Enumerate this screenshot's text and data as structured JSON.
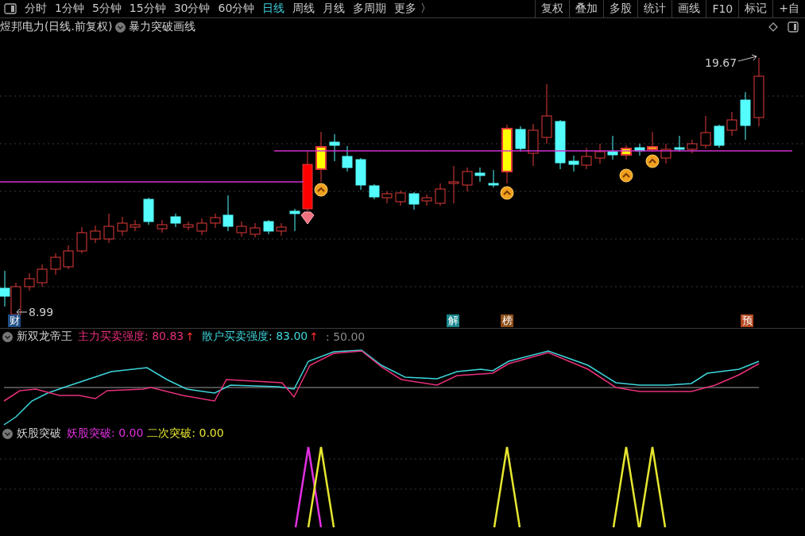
{
  "toolbar": {
    "periods": [
      {
        "label": "分时",
        "selected": false
      },
      {
        "label": "1分钟",
        "selected": false
      },
      {
        "label": "5分钟",
        "selected": false
      },
      {
        "label": "15分钟",
        "selected": false
      },
      {
        "label": "30分钟",
        "selected": false
      },
      {
        "label": "60分钟",
        "selected": false
      },
      {
        "label": "日线",
        "selected": true
      },
      {
        "label": "周线",
        "selected": false
      },
      {
        "label": "月线",
        "selected": false
      },
      {
        "label": "多周期",
        "selected": false
      }
    ],
    "more": "更多 〉",
    "tools": [
      "复权",
      "叠加",
      "多股",
      "统计",
      "画线",
      "F10",
      "标记",
      "+自"
    ]
  },
  "chart": {
    "title": "煜邦电力(日线.前复权)",
    "overlay": "暴力突破画线",
    "high_label": "19.67",
    "low_label": "8.99",
    "badges": [
      {
        "text": "财",
        "color": "#1f4f86"
      },
      {
        "text": "解",
        "color": "#16878c"
      },
      {
        "text": "榜",
        "color": "#8c4d16"
      },
      {
        "text": "预",
        "color": "#b4461e"
      }
    ]
  },
  "indicators": [
    {
      "name": "新双龙帝王",
      "kind": "lines",
      "legend": [
        {
          "text": "主力买卖强度: 80.83",
          "arrow": "↑",
          "color": "#e8307a"
        },
        {
          "text": "散户买卖强度: 83.00",
          "arrow": "↑",
          "color": "#3ed6dc"
        },
        {
          "text": ": 50.00",
          "color": "#8a8a8a"
        }
      ]
    },
    {
      "name": "妖股突破",
      "kind": "spikes",
      "legend": [
        {
          "text": "妖股突破: 0.00",
          "color": "#e030e0"
        },
        {
          "text": "二次突破: 0.00",
          "color": "#e6e630"
        }
      ]
    }
  ]
}
